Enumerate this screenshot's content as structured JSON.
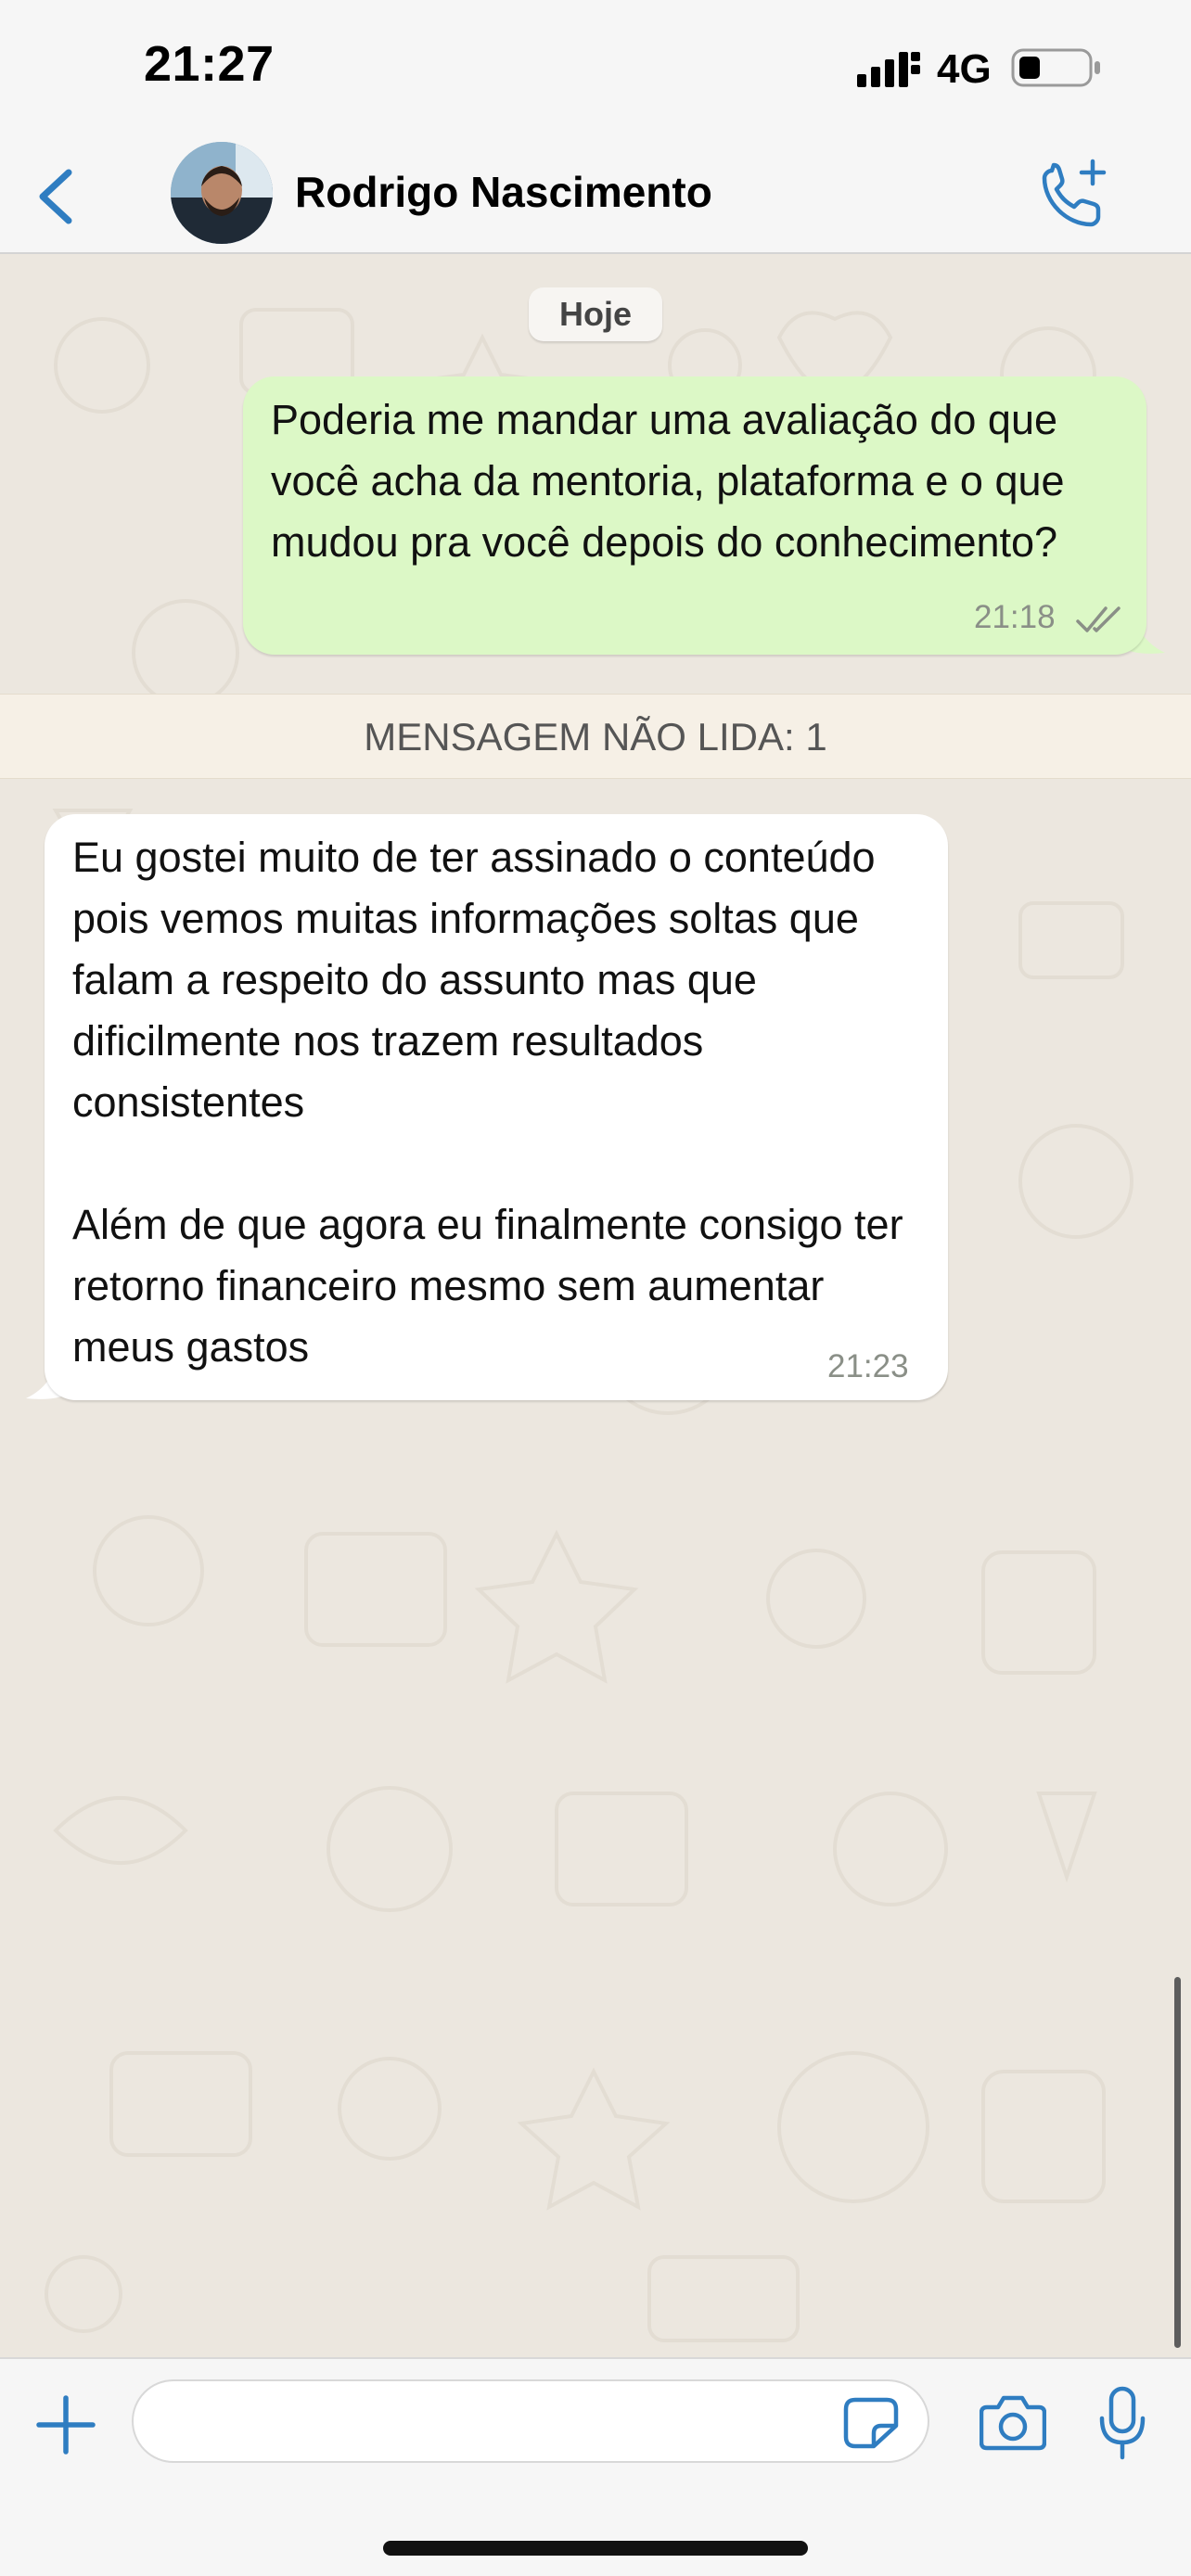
{
  "status_bar": {
    "time": "21:27",
    "network": "4G"
  },
  "header": {
    "contact_name": "Rodrigo Nascimento"
  },
  "chat": {
    "date_label": "Hoje",
    "outgoing_message": {
      "text": "Poderia me mandar uma avaliação do que você acha da mentoria, plataforma e o que mudou pra você depois do conhecimento?",
      "time": "21:18",
      "status": "read"
    },
    "unread_label": "MENSAGEM NÃO LIDA: 1",
    "incoming_message": {
      "text": "Eu gostei muito de ter assinado o conteúdo pois vemos muitas informações soltas que falam a respeito do assunto mas que dificilmente nos trazem resultados consistentes\n\nAlém de que agora eu finalmente consigo ter retorno financeiro mesmo sem aumentar meus gastos",
      "time": "21:23"
    }
  },
  "composer": {
    "placeholder": ""
  },
  "colors": {
    "accent": "#2f7dc1",
    "outgoing_bubble": "#dcf8c6",
    "incoming_bubble": "#ffffff",
    "chat_background": "#ece7df",
    "read_ticks": "#8a8f87"
  },
  "icons": [
    "back-chevron-icon",
    "add-call-icon",
    "plus-icon",
    "sticker-icon",
    "camera-icon",
    "microphone-icon",
    "signal-icon",
    "battery-icon",
    "read-ticks-icon"
  ]
}
